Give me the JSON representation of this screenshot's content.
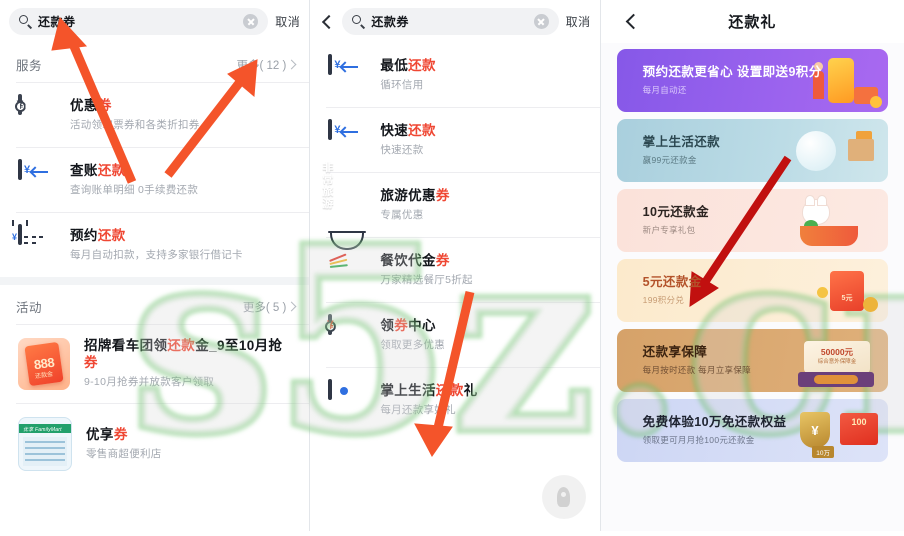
{
  "search": {
    "query": "还款券",
    "cancel_label": "取消",
    "search_icon": "search-icon",
    "clear_icon": "clear-circle-icon",
    "back_icon": "chevron-left-icon"
  },
  "left_panel": {
    "sections": [
      {
        "title": "服务",
        "more_label": "更多( 12 )",
        "items": [
          {
            "title_plain": "优惠",
            "title_highlight": "券",
            "subtitle": "活动领取票券和各类折扣券",
            "icon": "coupon-ticket-icon"
          },
          {
            "title_plain": "查账",
            "title_highlight": "还款",
            "subtitle": "查询账单明细 0手续费还款",
            "icon": "card-repay-icon"
          },
          {
            "title_plain": "预约",
            "title_highlight": "还款",
            "subtitle": "每月自动扣款，支持多家银行借记卡",
            "icon": "calendar-repay-icon"
          }
        ]
      },
      {
        "title": "活动",
        "more_label": "更多( 5 )",
        "items": [
          {
            "title_plain": "招牌看车团领",
            "title_highlight": "还款",
            "title_tail": "金_9至10月抢",
            "title_tail_hl": "券",
            "subtitle": "9-10月抢券并放款客户领取",
            "icon": "red-envelope-888-thumb"
          },
          {
            "title_plain": "优享",
            "title_highlight": "券",
            "subtitle": "零售商超便利店",
            "icon": "retail-store-thumb"
          }
        ]
      }
    ]
  },
  "middle_panel": {
    "items": [
      {
        "title_plain": "最低",
        "title_highlight": "还款",
        "subtitle": "循环信用",
        "icon": "card-repay-icon"
      },
      {
        "title_plain": "快速",
        "title_highlight": "还款",
        "subtitle": "快速还款",
        "icon": "card-repay-icon"
      },
      {
        "title_plain": "旅游优惠",
        "title_highlight": "券",
        "subtitle": "专属优惠",
        "icon": "travel-tile-icon",
        "icon_text": [
          "非常",
          "旅游"
        ]
      },
      {
        "title_plain": "餐饮代金",
        "title_highlight": "券",
        "subtitle": "万家精选餐厅5折起",
        "icon": "noodle-bowl-icon"
      },
      {
        "title_plain": "领",
        "title_highlight": "券",
        "title_tail": "中心",
        "subtitle": "领取更多优惠",
        "icon": "coupon-ticket-icon"
      },
      {
        "title_plain": "掌上生活",
        "title_highlight": "还款",
        "title_tail": "礼",
        "subtitle": "每月还款享好礼",
        "icon": "dot-card-icon"
      }
    ],
    "back_to_top_icon": "rocket-icon"
  },
  "right_panel": {
    "nav_title": "还款礼",
    "back_icon": "chevron-left-icon",
    "banners": [
      {
        "title": "预约还款更省心 设置即送9积分",
        "subtitle": "每月自动还",
        "art": "phone-gift-art",
        "accent": "#9b63ee"
      },
      {
        "title": "掌上生活还款",
        "subtitle": "赢99元还款金",
        "art": "snowglobe-art",
        "accent": "#bcdce6"
      },
      {
        "title": "10元还款金",
        "subtitle": "新户专享礼包",
        "art": "cat-basket-art",
        "accent": "#fce9e2"
      },
      {
        "title": "5元还款金",
        "subtitle": "199积分兑",
        "art": "red-envelope-art",
        "accent": "#fdf0dc",
        "envelope_label": "5元"
      },
      {
        "title": "还款享保障",
        "subtitle": "每月按时还款 每月立享保障",
        "art": "insurance-card-art",
        "accent": "#dfb07a",
        "card_amount": "50000元",
        "card_note": "综合意外保障金"
      },
      {
        "title": "免费体验10万免还款权益",
        "subtitle": "领取更可月月抢100元还款金",
        "art": "shield-envelope-art",
        "accent": "#dde3f8",
        "shield_tag": "10万",
        "envelope_amount": "100"
      }
    ]
  },
  "watermark": {
    "text": "s5z.cn",
    "color": "#7ac87a"
  },
  "annotations": {
    "orange_arrows": 4,
    "red_arrows": 1,
    "orange_color": "#f4542a",
    "red_color": "#c1100f"
  }
}
